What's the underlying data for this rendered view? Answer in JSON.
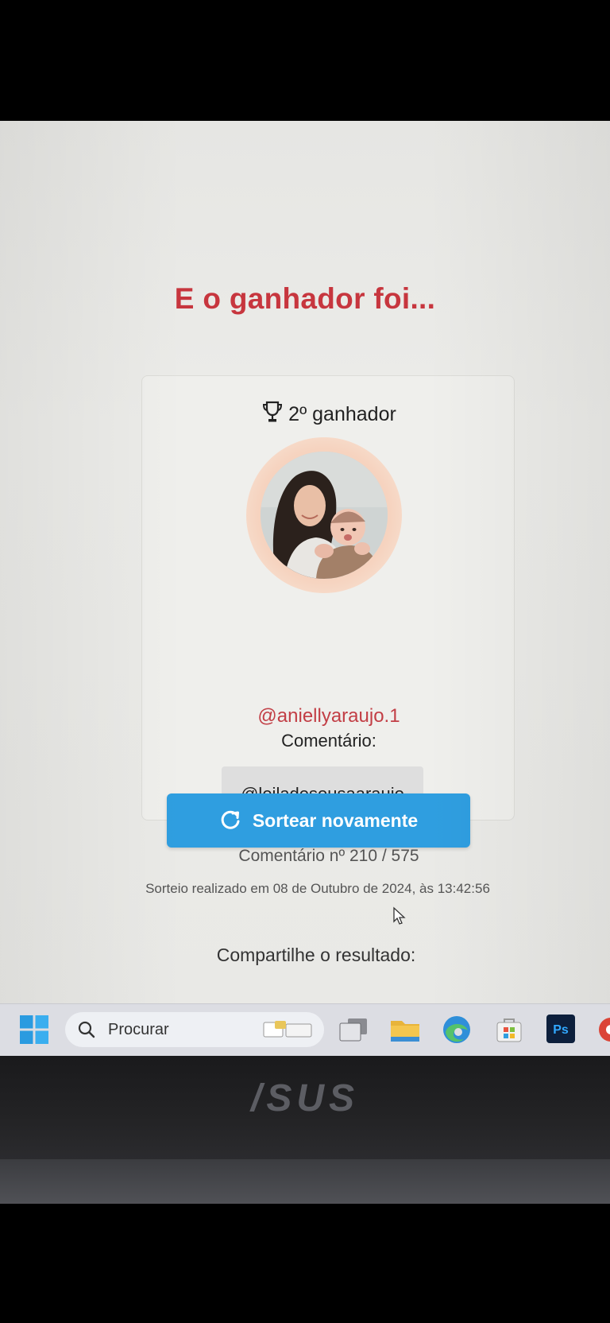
{
  "heading": "E o ganhador foi...",
  "winner": {
    "rank_label": "2º ganhador",
    "username": "@aniellyaraujo.1",
    "comment_label": "Comentário:",
    "comment_text": "@leiladesousaaraujo",
    "comment_index": "Comentário nº 210 / 575"
  },
  "actions": {
    "redraw_label": "Sortear novamente"
  },
  "draw_info": "Sorteio realizado em 08 de Outubro de 2024, às 13:42:56",
  "share_label": "Compartilhe o resultado:",
  "taskbar": {
    "search_placeholder": "Procurar",
    "apps": [
      "start-icon",
      "search-icon",
      "task-view-icon",
      "file-explorer-icon",
      "edge-icon",
      "store-icon",
      "photoshop-icon",
      "chrome-icon"
    ]
  },
  "device": {
    "brand": "/SUS"
  },
  "colors": {
    "heading": "#c7363e",
    "username": "#c23e45",
    "button": "#2f9ee0",
    "avatar_ring": "#f6d3bf"
  }
}
